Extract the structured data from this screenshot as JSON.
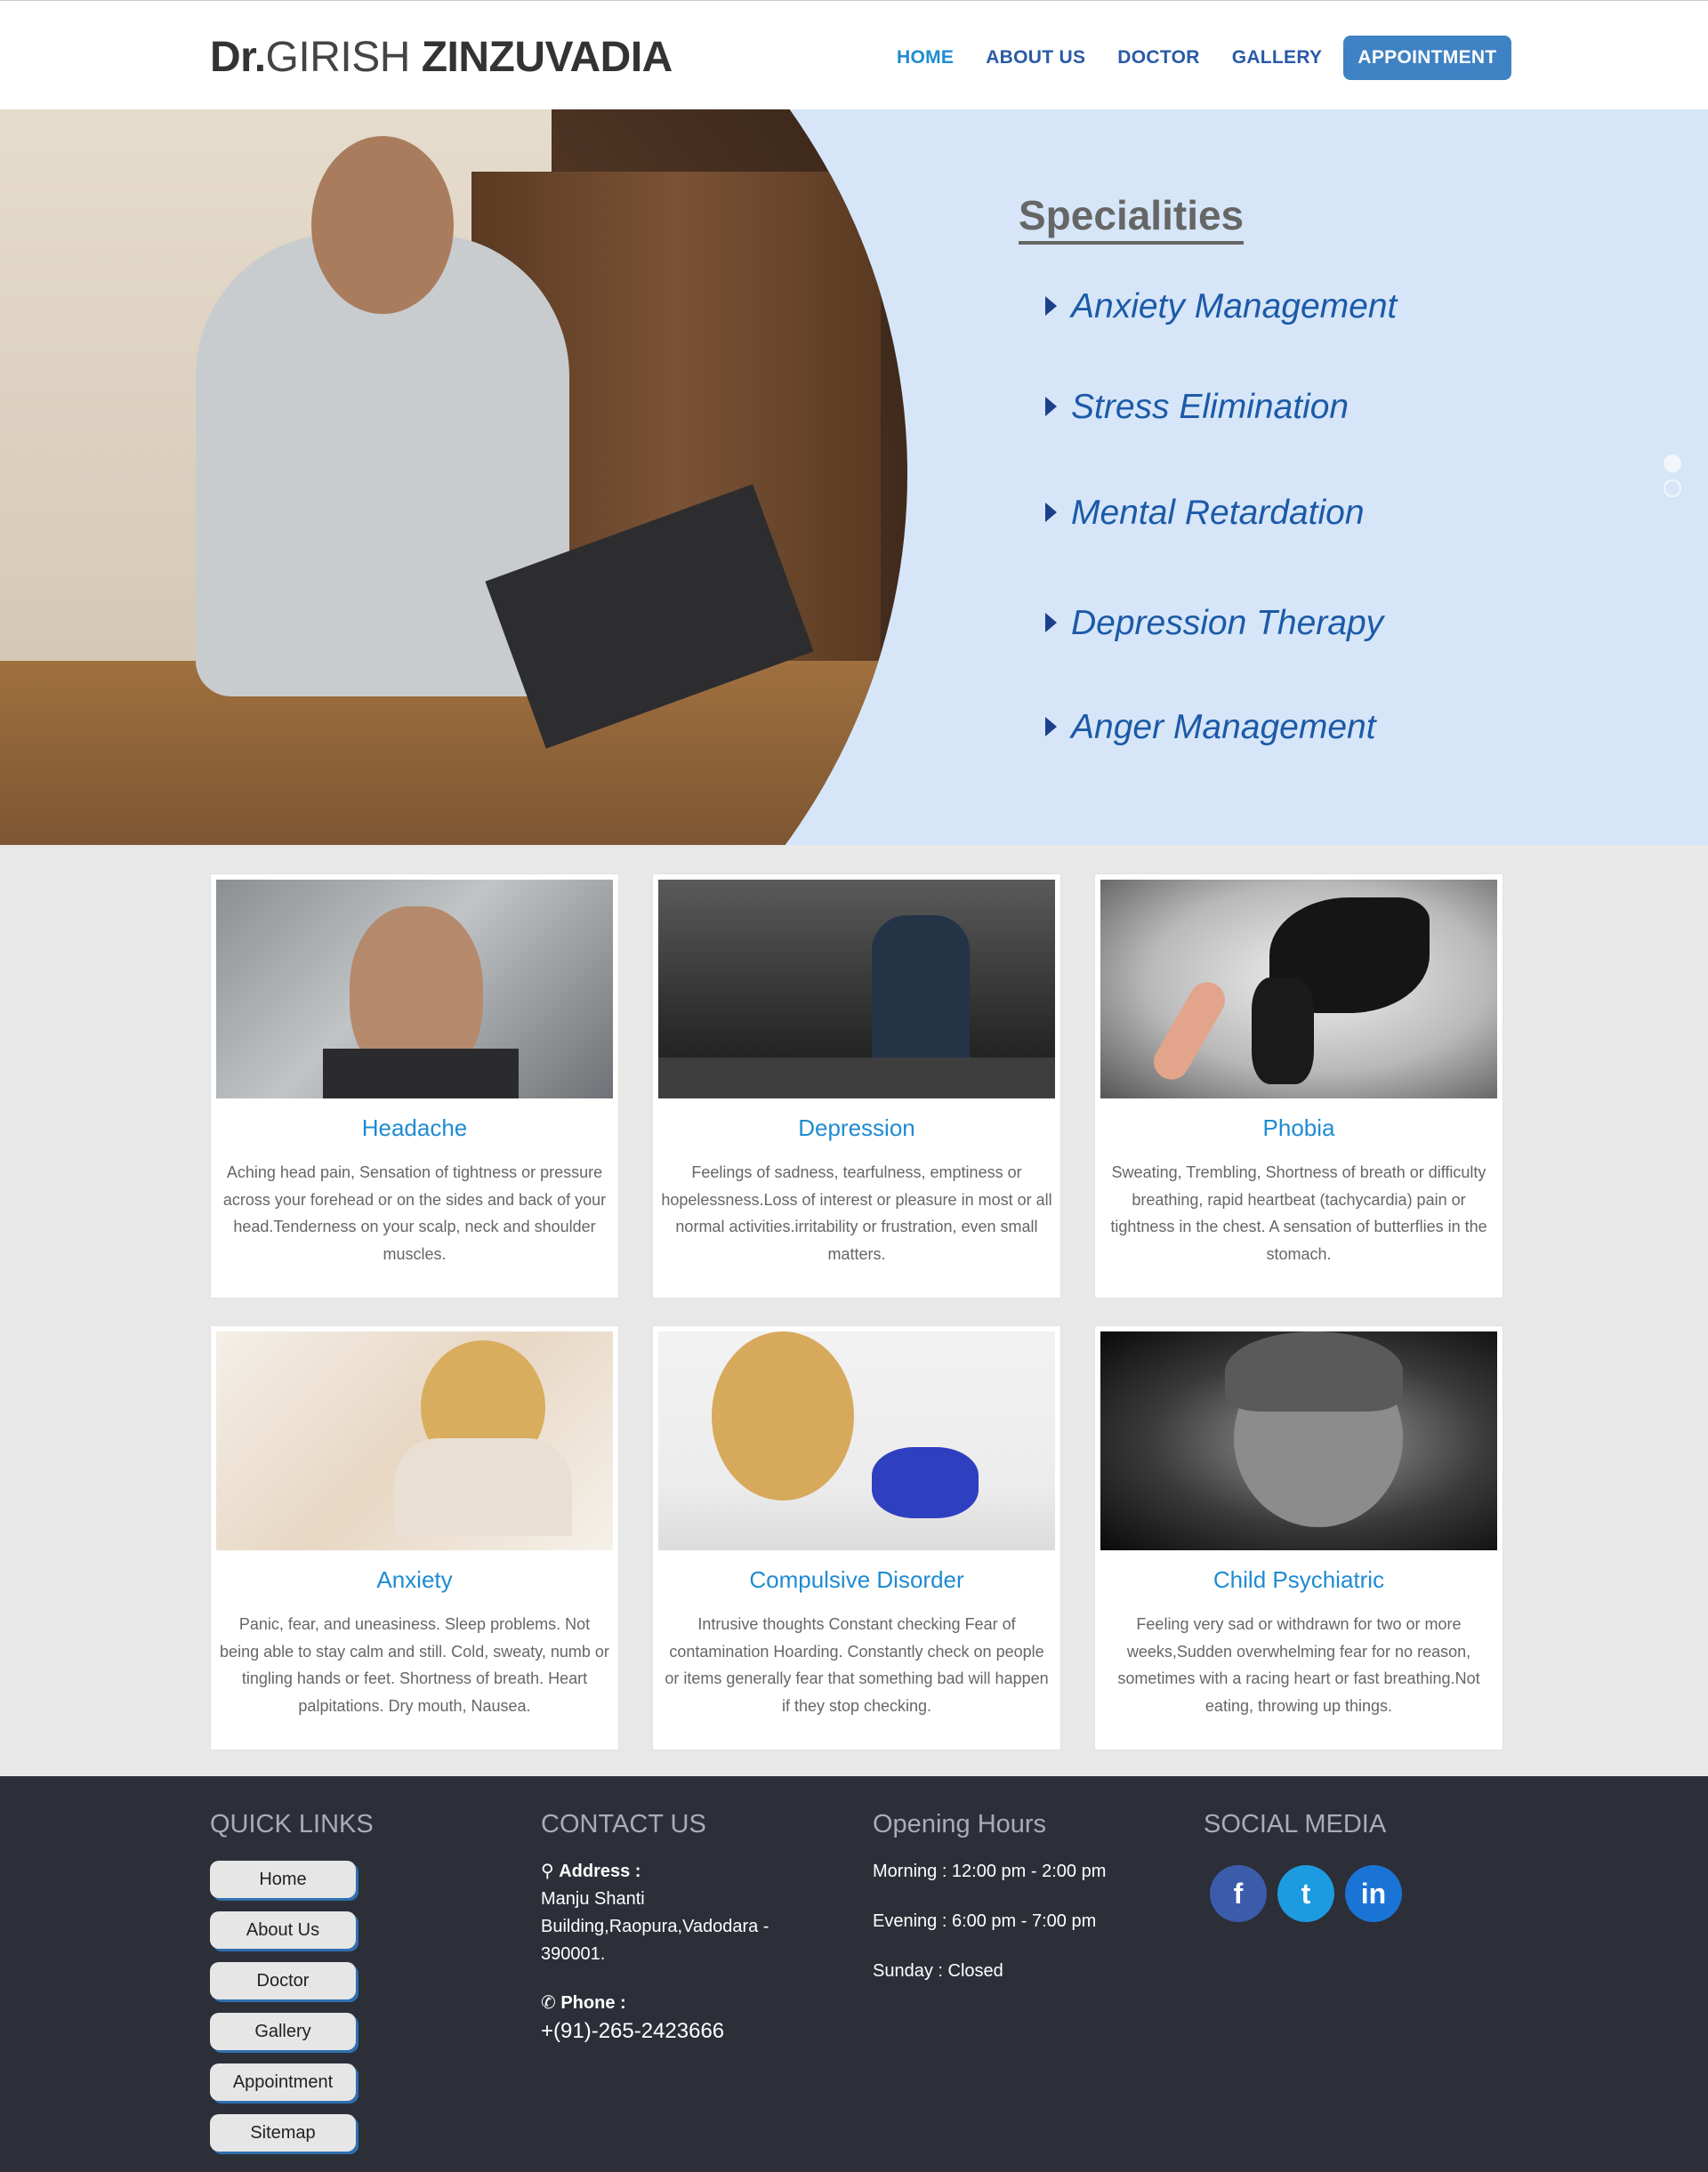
{
  "header": {
    "logo_prefix": "Dr.",
    "logo_first": "GIRISH",
    "logo_last": "ZINZUVADIA",
    "nav": [
      "HOME",
      "ABOUT US",
      "DOCTOR",
      "GALLERY",
      "APPOINTMENT"
    ]
  },
  "hero": {
    "title": "Specialities",
    "items": [
      "Anxiety Management",
      "Stress Elimination",
      "Mental Retardation",
      "Depression Therapy",
      "Anger Management"
    ]
  },
  "cards": [
    {
      "title": "Headache",
      "text": "Aching head pain, Sensation of tightness or pressure across your forehead or on the sides and back of your head.Tenderness on your scalp, neck and shoulder muscles."
    },
    {
      "title": "Depression",
      "text": "Feelings of sadness, tearfulness, emptiness or hopelessness.Loss of interest or pleasure in most or all normal activities.irritability or frustration, even small matters."
    },
    {
      "title": "Phobia",
      "text": "Sweating, Trembling, Shortness of breath or difficulty breathing, rapid heartbeat (tachycardia) pain or tightness in the chest. A sensation of butterflies in the stomach."
    },
    {
      "title": "Anxiety",
      "text": "Panic, fear, and uneasiness. Sleep problems. Not being able to stay calm and still. Cold, sweaty, numb or tingling hands or feet. Shortness of breath. Heart palpitations. Dry mouth, Nausea."
    },
    {
      "title": "Compulsive Disorder",
      "text": "Intrusive thoughts Constant checking Fear of contamination Hoarding. Constantly check on people or items generally fear that something bad will happen if they stop checking."
    },
    {
      "title": "Child Psychiatric",
      "text": "Feeling very sad or withdrawn for two or more weeks,Sudden overwhelming fear for no reason, sometimes with a racing heart or fast breathing.Not eating, throwing up things."
    }
  ],
  "footer": {
    "quick_links_title": "QUICK LINKS",
    "quick_links": [
      "Home",
      "About Us",
      "Doctor",
      "Gallery",
      "Appointment",
      "Sitemap"
    ],
    "contact_title": "CONTACT US",
    "address_label": "Address :",
    "address_lines": [
      "Manju Shanti",
      "Building,Raopura,Vadodara -",
      "390001."
    ],
    "phone_label": "Phone :",
    "phone": "+(91)-265-2423666",
    "hours_title": "Opening Hours",
    "hours": [
      "Morning : 12:00 pm - 2:00 pm",
      "Evening : 6:00 pm - 7:00 pm",
      "Sunday : Closed"
    ],
    "social_title": "SOCIAL MEDIA",
    "social": [
      {
        "icon": "facebook-icon",
        "glyph": "f"
      },
      {
        "icon": "twitter-icon",
        "glyph": "t"
      },
      {
        "icon": "linkedin-icon",
        "glyph": "in"
      }
    ]
  },
  "colors": {
    "accent": "#1e8bd2",
    "nav": "#2a5aa8",
    "button": "#3f82c4",
    "footer": "#2c2f38",
    "hero": "#d6e6f8",
    "specialities": "#1c5aa8"
  }
}
